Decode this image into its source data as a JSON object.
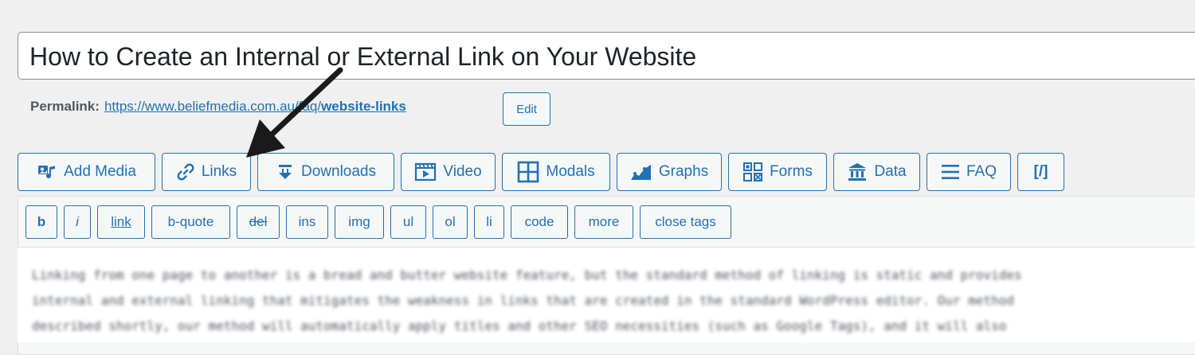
{
  "post": {
    "title": "How to Create an Internal or External Link on Your Website"
  },
  "permalink": {
    "label": "Permalink:",
    "url_base": "https://www.beliefmedia.com.au/faq/",
    "slug": "website-links",
    "edit_label": "Edit"
  },
  "media_buttons": [
    {
      "label": "Add Media",
      "icon": "add-media-icon"
    },
    {
      "label": "Links",
      "icon": "link-icon"
    },
    {
      "label": "Downloads",
      "icon": "download-icon"
    },
    {
      "label": "Video",
      "icon": "video-icon"
    },
    {
      "label": "Modals",
      "icon": "modals-grid-icon"
    },
    {
      "label": "Graphs",
      "icon": "graph-icon"
    },
    {
      "label": "Forms",
      "icon": "forms-icon"
    },
    {
      "label": "Data",
      "icon": "bank-icon"
    },
    {
      "label": "FAQ",
      "icon": "menu-icon"
    },
    {
      "label": "[/]",
      "icon": ""
    }
  ],
  "quicktags": [
    "b",
    "i",
    "link",
    "b-quote",
    "del",
    "ins",
    "img",
    "ul",
    "ol",
    "li",
    "code",
    "more",
    "close tags"
  ],
  "content": {
    "lines": [
      "Linking from one page to another is a bread and butter website feature, but the standard method of linking is static and provides",
      "internal and external linking that mitigates the weakness in links that are created in the standard WordPress editor. Our method",
      "described shortly, our method will automatically apply titles and other SEO necessities (such as Google Tags), and it will also"
    ]
  },
  "colors": {
    "accent": "#2271b1",
    "background": "#f0f0f1",
    "arrow": "#1a1a1a"
  }
}
